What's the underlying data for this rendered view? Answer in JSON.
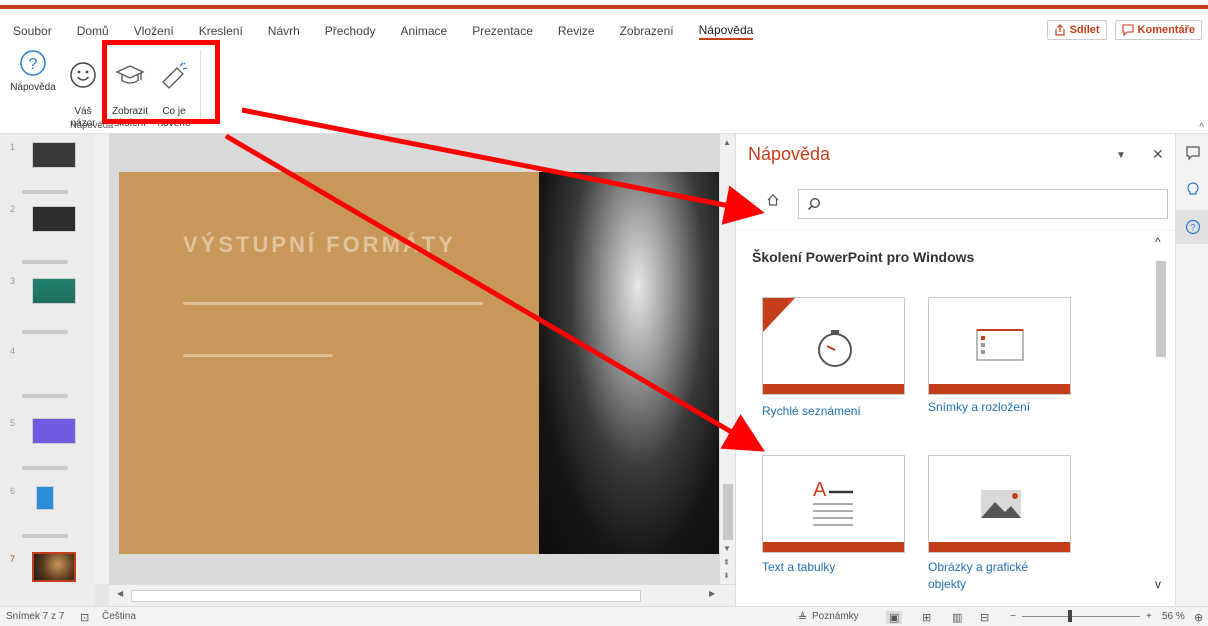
{
  "tabs": [
    "Soubor",
    "Domů",
    "Vložení",
    "Kreslení",
    "Návrh",
    "Přechody",
    "Animace",
    "Prezentace",
    "Revize",
    "Zobrazení",
    "Nápověda"
  ],
  "active_tab": "Nápověda",
  "share_label": "Sdílet",
  "comments_label": "Komentáře",
  "ribbon": {
    "help_label": "Nápověda",
    "feedback_label": "Váš\nnázor",
    "training_label": "Zobrazit\nškolení",
    "whatsnew_label": "Co je\nnového",
    "group_label": "Nápověda"
  },
  "slide": {
    "title": "VÝSTUPNÍ FORMÁTY"
  },
  "help_pane": {
    "title": "Nápověda",
    "search_value": "",
    "heading": "Školení PowerPoint pro Windows",
    "cards": [
      {
        "label": "Rychlé seznámení",
        "icon": "stopwatch-icon"
      },
      {
        "label": "Snímky a rozložení",
        "icon": "layout-icon"
      },
      {
        "label": "Text a tabulky",
        "icon": "text-icon"
      },
      {
        "label": "Obrázky a grafické objekty",
        "icon": "image-icon"
      }
    ]
  },
  "status": {
    "slide_info": "Snímek 7 z 7",
    "language": "Čeština",
    "notes_label": "Poznámky",
    "zoom": "56 %"
  },
  "colors": {
    "accent": "#c43e1c",
    "link": "#1f6fb2",
    "annotation": "#ff0000"
  }
}
